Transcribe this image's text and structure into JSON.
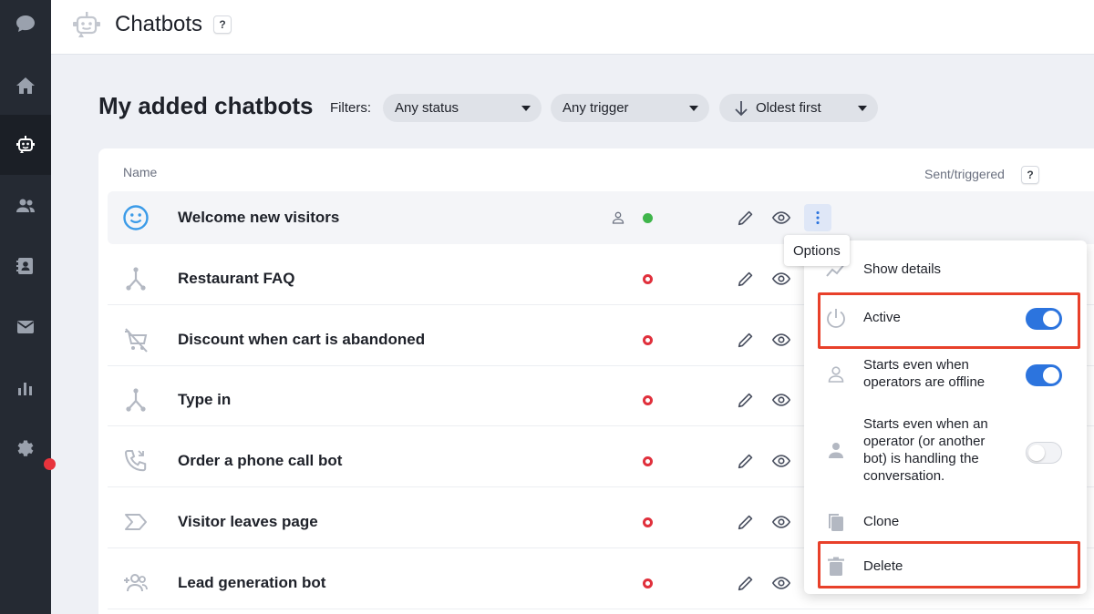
{
  "header": {
    "title": "Chatbots",
    "help": "?"
  },
  "toolbar": {
    "title": "My added chatbots",
    "filters_label": "Filters:",
    "status_filter": "Any status",
    "trigger_filter": "Any trigger",
    "sort": "Oldest first"
  },
  "table": {
    "col_name": "Name",
    "col_sent": "Sent/triggered",
    "col_sent_help": "?",
    "rows": [
      {
        "name": "Welcome new visitors",
        "icon": "smiley-icon",
        "status": "active"
      },
      {
        "name": "Restaurant FAQ",
        "icon": "branch-icon",
        "status": "inactive"
      },
      {
        "name": "Discount when cart is abandoned",
        "icon": "cart-off-icon",
        "status": "inactive"
      },
      {
        "name": "Type in",
        "icon": "branch-icon",
        "status": "inactive"
      },
      {
        "name": "Order a phone call bot",
        "icon": "phone-icon",
        "status": "inactive"
      },
      {
        "name": "Visitor leaves page",
        "icon": "exit-icon",
        "status": "inactive"
      },
      {
        "name": "Lead generation bot",
        "icon": "add-users-icon",
        "status": "inactive"
      }
    ]
  },
  "tooltip": {
    "text": "Options"
  },
  "menu": {
    "show_details": "Show details",
    "active": "Active",
    "offline_line1": "Starts even when",
    "offline_line2": "operators are offline",
    "handling_line1": "Starts even when an",
    "handling_line2": "operator (or another",
    "handling_line3": "bot) is handling the",
    "handling_line4": "conversation.",
    "clone": "Clone",
    "delete": "Delete"
  },
  "colors": {
    "sidebar": "#252a33",
    "accent": "#2c74de",
    "active_status": "#3fb54b",
    "inactive_status": "#e0303c",
    "highlight": "#e8402a"
  }
}
